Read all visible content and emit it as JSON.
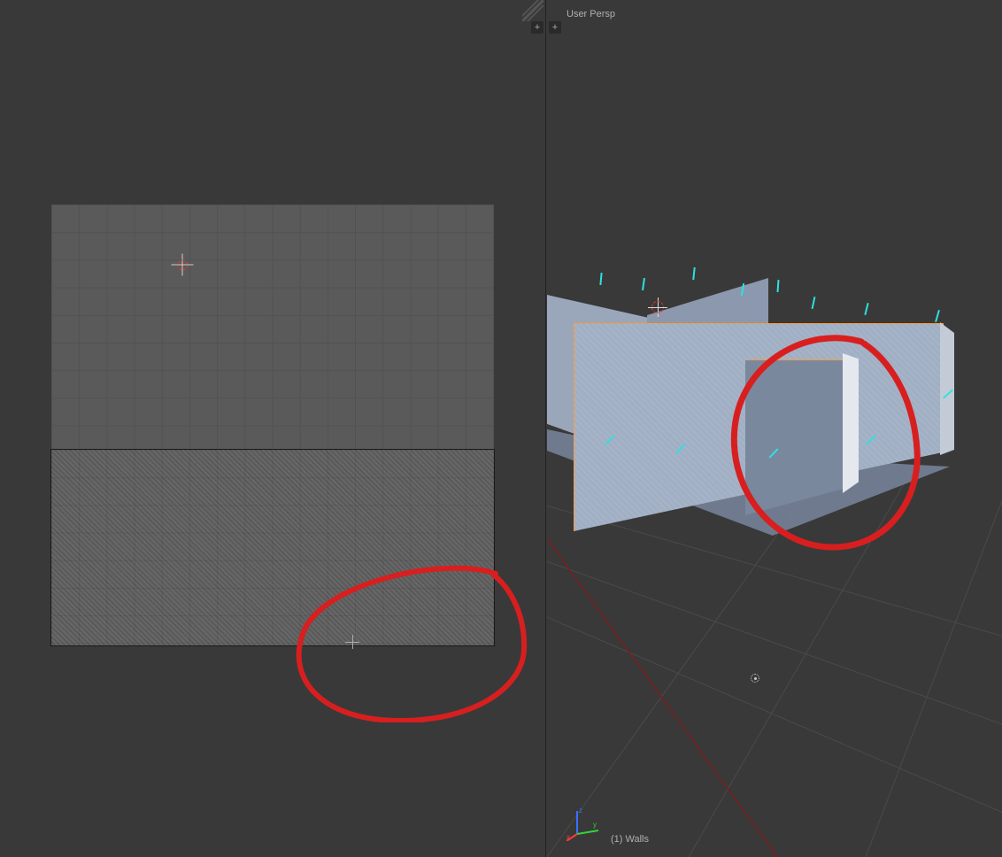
{
  "top_buttons": {
    "plus1_label": "+",
    "plus2_label": "+"
  },
  "left_panel": {
    "type": "uv-image-editor"
  },
  "right_panel": {
    "view_label": "User Persp",
    "object_label": "(1) Walls",
    "axes": {
      "x": "x",
      "y": "y",
      "z": "z"
    }
  }
}
